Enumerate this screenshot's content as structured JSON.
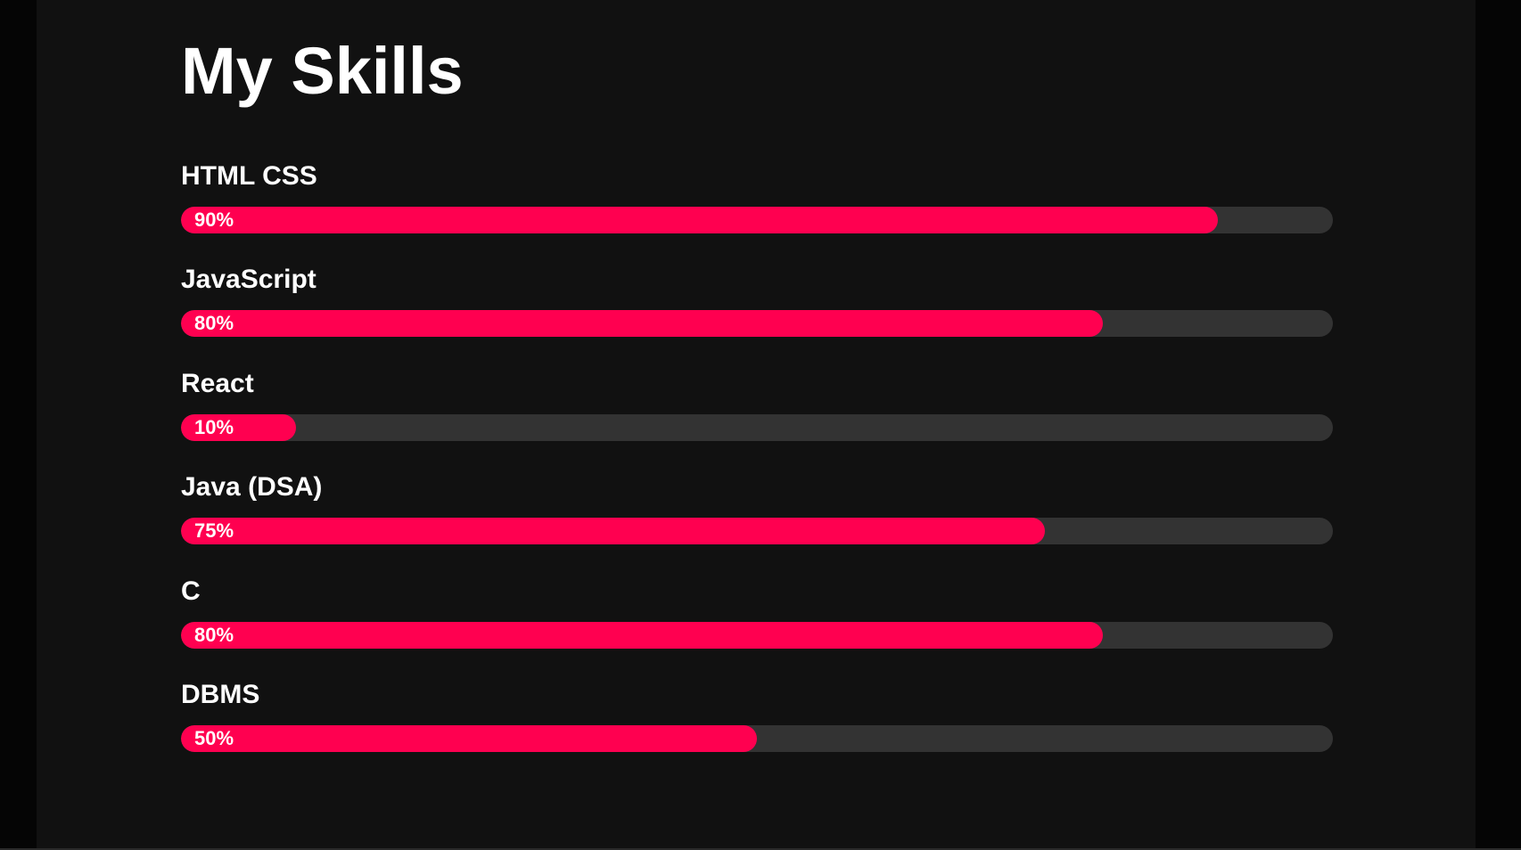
{
  "page": {
    "title": "My Skills"
  },
  "colors": {
    "background": "#111111",
    "outer_background": "#050505",
    "track": "#333333",
    "accent": "#ff0050",
    "text": "#ffffff"
  },
  "skills": [
    {
      "label": "HTML CSS",
      "percent": 90,
      "value_text": "90%"
    },
    {
      "label": "JavaScript",
      "percent": 80,
      "value_text": "80%"
    },
    {
      "label": "React",
      "percent": 10,
      "value_text": "10%"
    },
    {
      "label": "Java (DSA)",
      "percent": 75,
      "value_text": "75%"
    },
    {
      "label": "C",
      "percent": 80,
      "value_text": "80%"
    },
    {
      "label": "DBMS",
      "percent": 50,
      "value_text": "50%"
    }
  ]
}
